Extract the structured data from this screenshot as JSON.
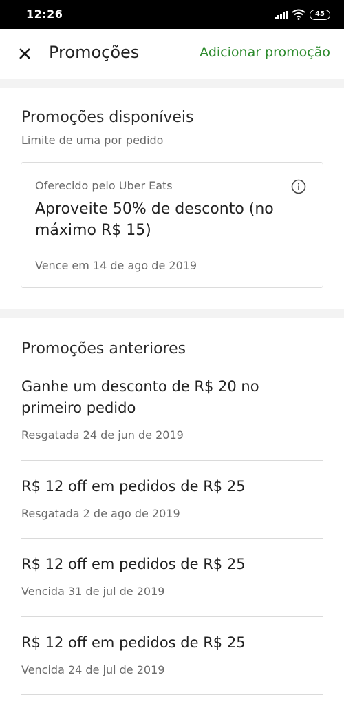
{
  "status_bar": {
    "time": "12:26",
    "battery": "45"
  },
  "header": {
    "title": "Promoções",
    "action": "Adicionar promoção",
    "close_icon": "close-icon"
  },
  "available": {
    "heading": "Promoções disponíveis",
    "subheading": "Limite de uma por pedido",
    "card": {
      "offered_by": "Oferecido pelo Uber Eats",
      "title": "Aproveite 50% de desconto (no máximo R$ 15)",
      "expires": "Vence em 14 de ago de 2019",
      "info_icon": "info-icon"
    }
  },
  "previous": {
    "heading": "Promoções anteriores",
    "items": [
      {
        "title": "Ganhe um desconto de R$ 20 no primeiro pedido",
        "date": "Resgatada 24 de jun de 2019"
      },
      {
        "title": "R$ 12 off em pedidos de R$ 25",
        "date": "Resgatada 2 de ago de 2019"
      },
      {
        "title": "R$ 12 off em pedidos de R$ 25",
        "date": "Vencida 31 de jul de 2019"
      },
      {
        "title": "R$ 12 off em pedidos de R$ 25",
        "date": "Vencida 24 de jul de 2019"
      }
    ]
  },
  "colors": {
    "accent": "#2e8b2e",
    "status_bar": "#000000",
    "secondary_text": "#6b6b6b"
  }
}
